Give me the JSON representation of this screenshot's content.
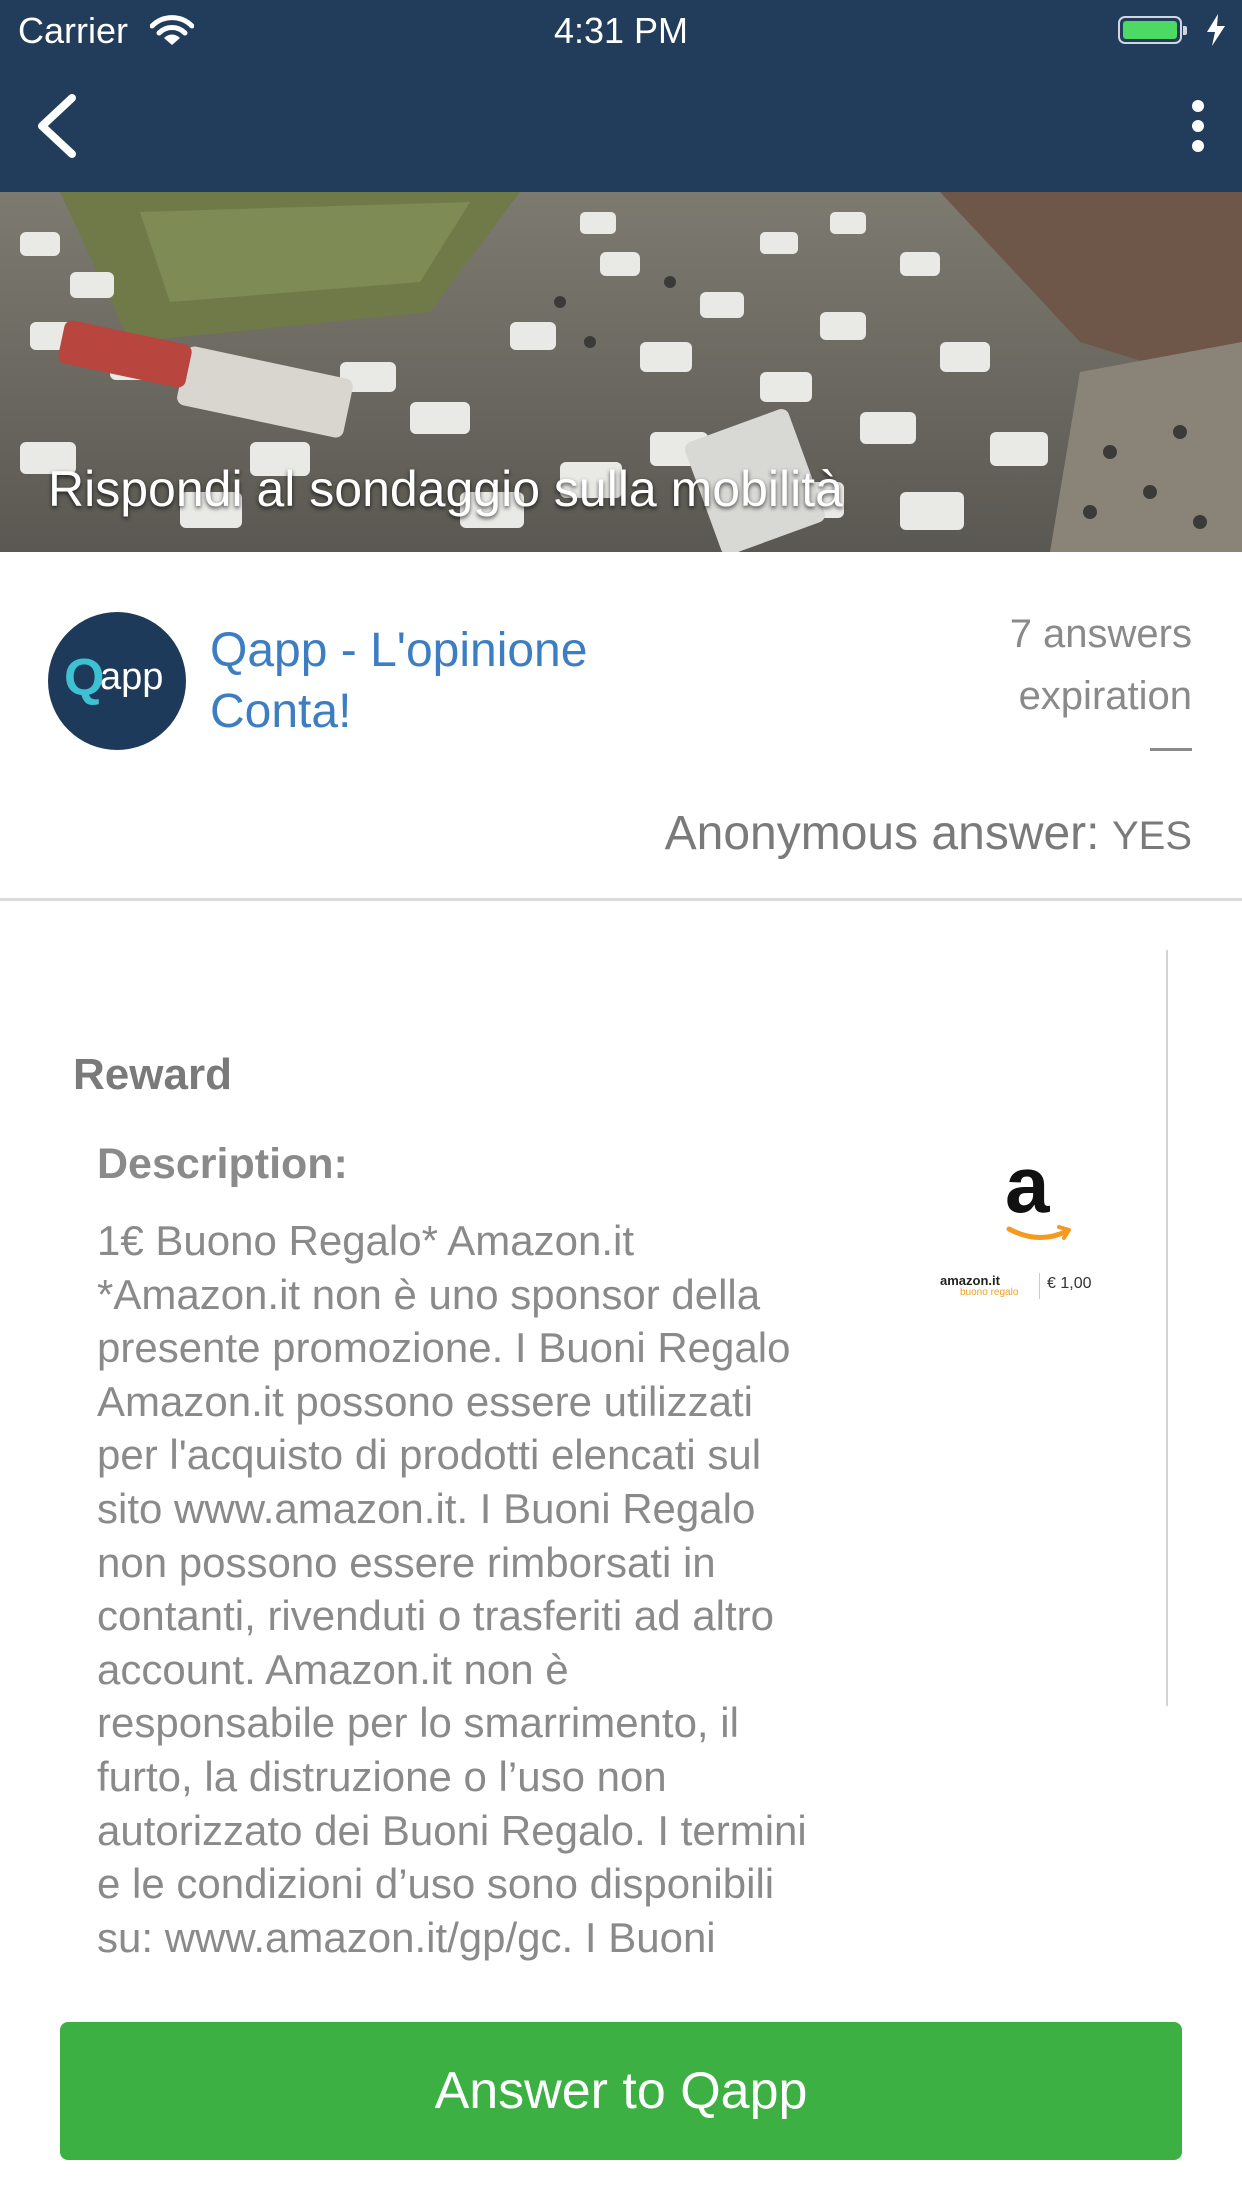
{
  "status_bar": {
    "carrier": "Carrier",
    "time": "4:31 PM"
  },
  "nav": {
    "back_icon": "chevron-left-icon",
    "more_icon": "more-vertical-icon"
  },
  "hero": {
    "title": "Rispondi al sondaggio sulla mobilità"
  },
  "author": {
    "name": "Qapp - L'opinione Conta!",
    "avatar_q": "Q",
    "avatar_app": "app"
  },
  "stats": {
    "answers": "7 answers",
    "expiration_label": "expiration",
    "anonymous_label": "Anonymous answer:",
    "anonymous_value": "YES"
  },
  "reward": {
    "heading": "Reward",
    "description_label": "Description:",
    "description": "1€ Buono Regalo* Amazon.it\n*Amazon.it non è uno sponsor della\npresente promozione. I Buoni Regalo\nAmazon.it possono essere utilizzati\nper l'acquisto di prodotti elencati sul\nsito www.amazon.it. I Buoni Regalo\nnon possono essere rimborsati in\ncontanti, rivenduti o trasferiti ad altro\naccount. Amazon.it non è\nresponsabile per lo smarrimento, il\nfurto, la distruzione o l’uso non\nautorizzato dei Buoni Regalo. I termini\ne le condizioni d’uso sono disponibili\nsu: www.amazon.it/gp/gc. I Buoni",
    "card": {
      "logo_letter": "a",
      "brand": "amazon.it",
      "sub": "buono regalo",
      "value": "€ 1,00"
    }
  },
  "action": {
    "button_label": "Answer to Qapp"
  },
  "colors": {
    "header_bg": "#223d5b",
    "link_blue": "#3d7dc2",
    "button_green": "#3cb043",
    "text_gray": "#8a8a8a"
  }
}
